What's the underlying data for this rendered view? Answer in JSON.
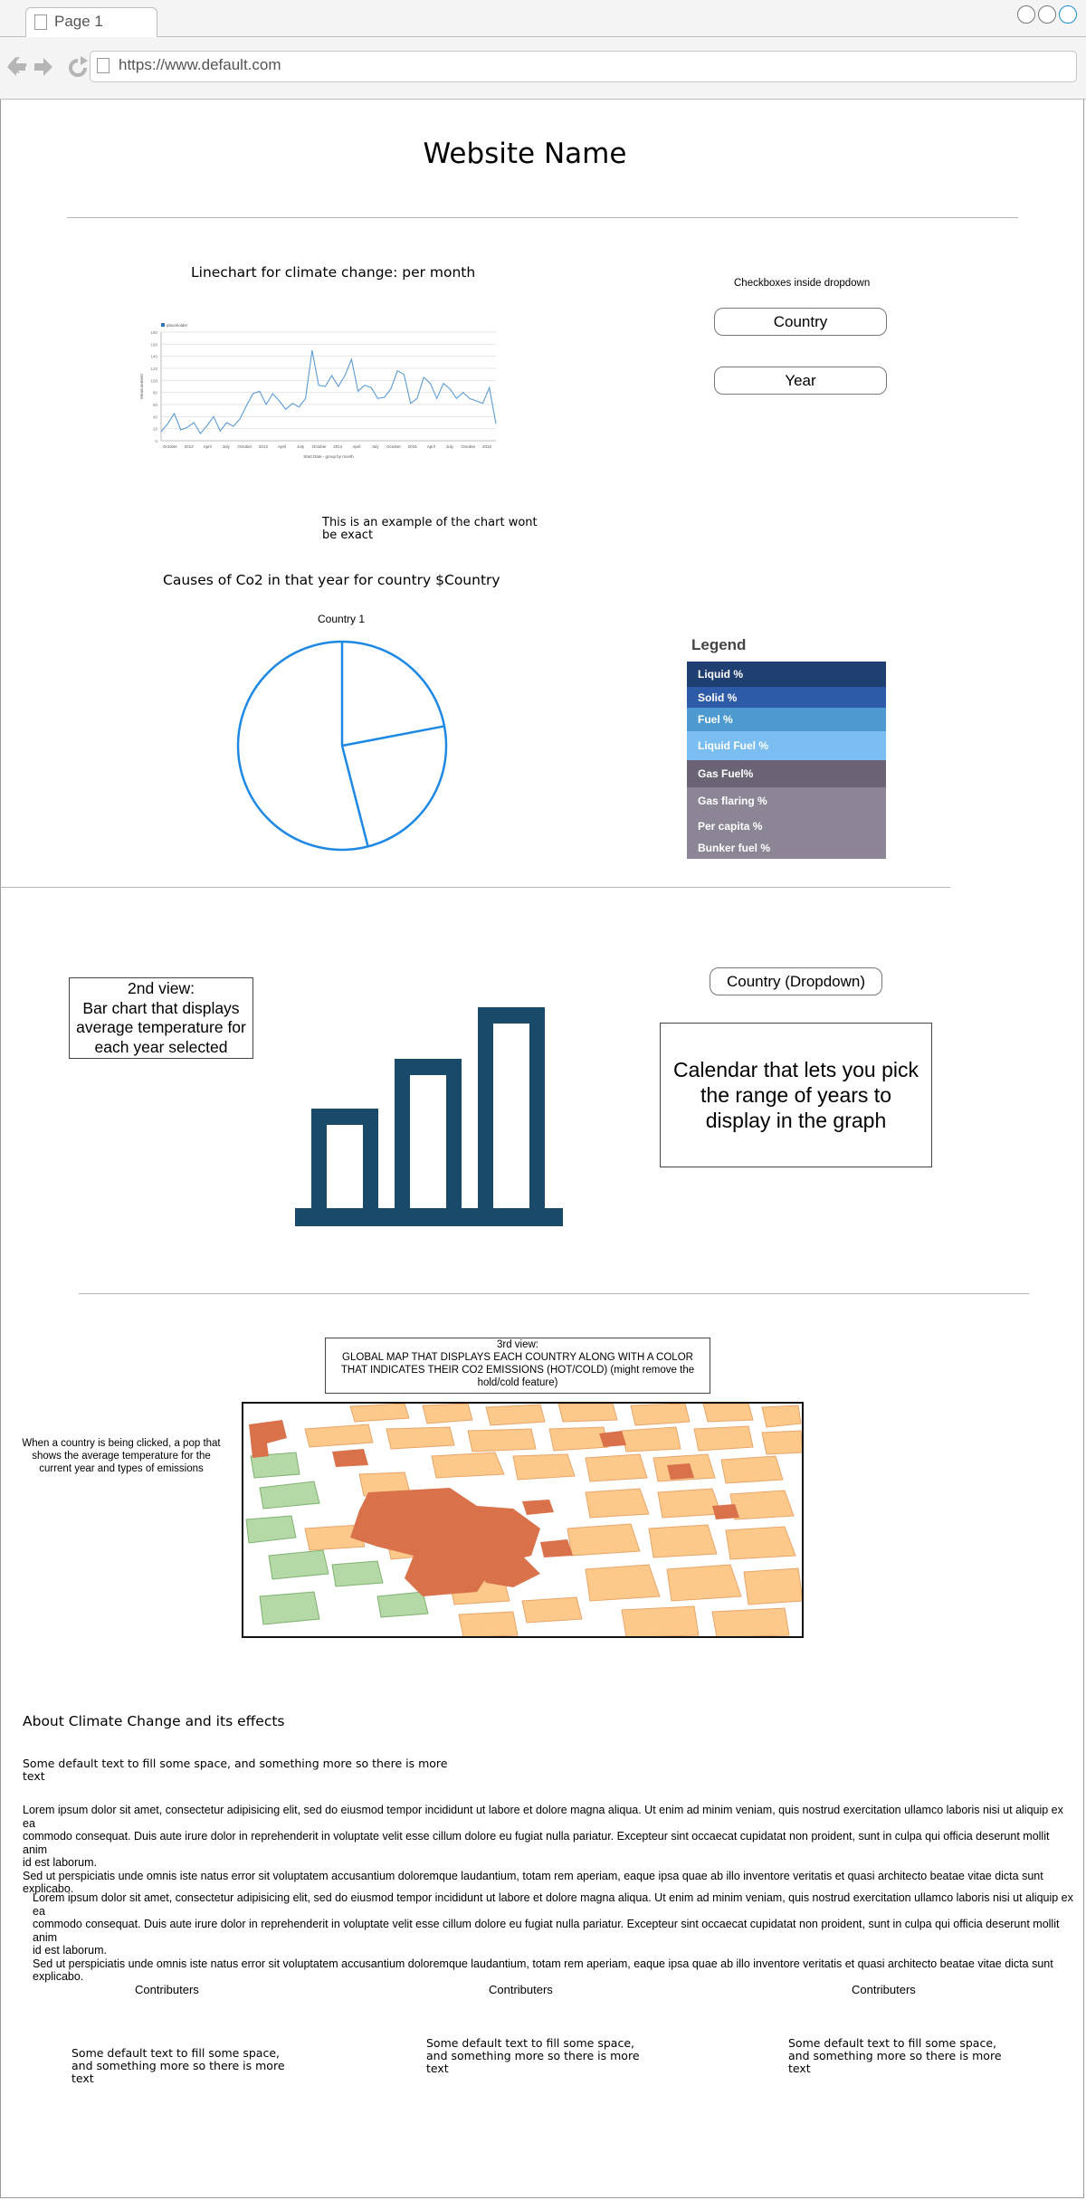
{
  "browser": {
    "tab_title": "Page 1",
    "url": "https://www.default.com"
  },
  "header": {
    "site_title": "Website Name"
  },
  "view1": {
    "linechart_title": "Linechart for climate change: per month",
    "chart_note": "This is an example of the chart wont be exact",
    "filters_caption": "Checkboxes inside dropdown",
    "country_button": "Country",
    "year_button": "Year"
  },
  "chart_data": {
    "type": "line",
    "title": "",
    "legend": "placeholder",
    "xlabel": "Start Date - group by month",
    "ylabel": "Measurement",
    "x": [
      "October",
      "2012",
      "April",
      "July",
      "October",
      "2013",
      "April",
      "July",
      "October",
      "2014",
      "April",
      "July",
      "October",
      "2015",
      "April",
      "July",
      "October",
      "2016"
    ],
    "ylim": [
      0,
      180
    ],
    "series": [
      {
        "name": "placeholder",
        "values": [
          15,
          28,
          45,
          18,
          22,
          30,
          12,
          25,
          40,
          16,
          30,
          24,
          36,
          58,
          78,
          82,
          60,
          78,
          66,
          52,
          62,
          56,
          70,
          150,
          92,
          90,
          108,
          90,
          108,
          135,
          82,
          92,
          88,
          70,
          72,
          86,
          116,
          110,
          62,
          70,
          105,
          95,
          70,
          95,
          86,
          70,
          80,
          70,
          66,
          62,
          88,
          28
        ]
      }
    ],
    "grid": true
  },
  "pie": {
    "section_title": "Causes of Co2 in that year for country $Country",
    "chart_title": "Country 1",
    "slices": [
      22,
      24,
      54
    ]
  },
  "legend": {
    "title": "Legend",
    "items": [
      {
        "label": "Liquid %",
        "color": "#1f3f72"
      },
      {
        "label": "Solid %",
        "color": "#2d5ba7"
      },
      {
        "label": "Fuel %",
        "color": "#4d9ad1"
      },
      {
        "label": "Liquid Fuel %",
        "color": "#7abdf0"
      },
      {
        "label": "Gas Fuel%",
        "color": "#6a6373"
      },
      {
        "label": "Gas flaring %",
        "color": "#8c8596"
      },
      {
        "label": "Per capita %",
        "color": "#8c8596"
      },
      {
        "label": "Bunker fuel %",
        "color": "#8c8596"
      }
    ]
  },
  "view2": {
    "description_lines": [
      "2nd view:",
      "Bar chart that displays",
      "average temperature for",
      "each year selected"
    ],
    "bar_icon": "bar-chart-icon",
    "bar_color": "#1a4a69",
    "country_dropdown": "Country (Dropdown)",
    "calendar_lines": [
      "Calendar that lets you pick",
      "the range of years to",
      "display in the graph"
    ]
  },
  "view3": {
    "map_caption_lines": [
      "3rd view:",
      "GLOBAL MAP THAT DISPLAYS EACH COUNTRY ALONG WITH A COLOR",
      "THAT INDICATES THEIR CO2 EMISSIONS  (HOT/COLD)  (might remove the",
      "hold/cold feature)"
    ],
    "click_note_lines": [
      "When a country is being clicked, a pop that",
      "shows the average temperature for the",
      "current year and types of emissions"
    ],
    "map_icon": "map-image"
  },
  "about": {
    "title": "About Climate Change and its effects",
    "intro_lines": [
      "Some default text to fill some space, and something more so there is more",
      "text"
    ],
    "para1_lines": [
      "Lorem ipsum dolor sit amet, consectetur adipisicing elit, sed do eiusmod tempor incididunt ut labore et dolore magna aliqua. Ut enim ad minim veniam, quis nostrud exercitation ullamco laboris nisi ut aliquip ex ea",
      "commodo consequat. Duis aute irure dolor in reprehenderit in voluptate velit esse cillum dolore eu fugiat nulla pariatur. Excepteur sint occaecat cupidatat non proident, sunt in culpa qui officia deserunt mollit anim",
      "id est laborum.",
      "Sed ut perspiciatis unde omnis iste natus error sit voluptatem accusantium doloremque laudantium, totam rem aperiam, eaque ipsa quae ab illo inventore veritatis et quasi architecto beatae vitae dicta sunt",
      "explicabo."
    ],
    "para2_lines": [
      "Lorem ipsum dolor sit amet, consectetur adipisicing elit, sed do eiusmod tempor incididunt ut labore et dolore magna aliqua. Ut enim ad minim veniam, quis nostrud exercitation ullamco laboris nisi ut aliquip ex ea",
      "commodo consequat. Duis aute irure dolor in reprehenderit in voluptate velit esse cillum dolore eu fugiat nulla pariatur. Excepteur sint occaecat cupidatat non proident, sunt in culpa qui officia deserunt mollit anim",
      "id est laborum.",
      "Sed ut perspiciatis unde omnis iste natus error sit voluptatem accusantium doloremque laudantium, totam rem aperiam, eaque ipsa quae ab illo inventore veritatis et quasi architecto beatae vitae dicta sunt",
      "explicabo."
    ]
  },
  "contributors": [
    {
      "heading": "Contributers",
      "lines": [
        "Some default text to fill some space,",
        "and something more so there is more",
        "text"
      ]
    },
    {
      "heading": "Contributers",
      "lines": [
        "Some default text to fill some space,",
        "and something more so there is more",
        "text"
      ]
    },
    {
      "heading": "Contributers",
      "lines": [
        "Some default text to fill some space,",
        "and something more so there is more",
        "text"
      ]
    }
  ]
}
